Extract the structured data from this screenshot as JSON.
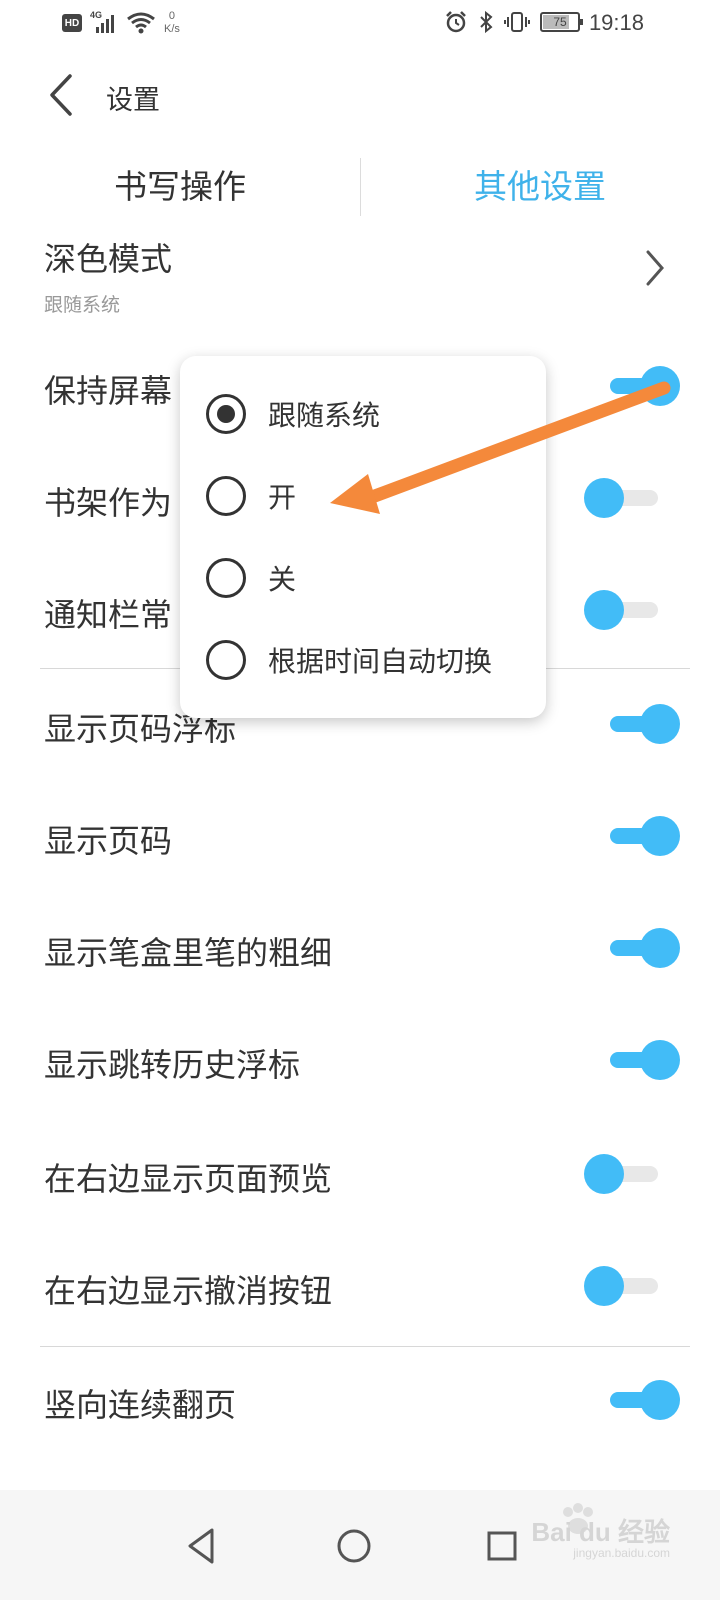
{
  "status_bar": {
    "hd": "HD",
    "network": "4G",
    "speed_value": "0",
    "speed_unit": "K/s",
    "battery": "75",
    "time": "19:18"
  },
  "header": {
    "title": "设置"
  },
  "tabs": [
    {
      "label": "书写操作",
      "active": false
    },
    {
      "label": "其他设置",
      "active": true
    }
  ],
  "dark_mode": {
    "label": "深色模式",
    "value": "跟随系统"
  },
  "settings": [
    {
      "label": "保持屏幕",
      "enabled": true
    },
    {
      "label": "书架作为",
      "enabled": false
    },
    {
      "label": "通知栏常",
      "enabled": false
    },
    {
      "label": "显示页码浮标",
      "enabled": true
    },
    {
      "label": "显示页码",
      "enabled": true
    },
    {
      "label": "显示笔盒里笔的粗细",
      "enabled": true
    },
    {
      "label": "显示跳转历史浮标",
      "enabled": true
    },
    {
      "label": "在右边显示页面预览",
      "enabled": false
    },
    {
      "label": "在右边显示撤消按钮",
      "enabled": false
    },
    {
      "label": "竖向连续翻页",
      "enabled": true
    }
  ],
  "popup": {
    "options": [
      {
        "label": "跟随系统",
        "selected": true
      },
      {
        "label": "开",
        "selected": false
      },
      {
        "label": "关",
        "selected": false
      },
      {
        "label": "根据时间自动切换",
        "selected": false
      }
    ]
  },
  "watermark": {
    "brand": "Bai du 经验",
    "site": "jingyan.baidu.com"
  },
  "colors": {
    "accent": "#42bcf7",
    "tab_active": "#3fb2ea",
    "annotation_arrow": "#f4893b"
  },
  "icons": {
    "back": "chevron-left-icon",
    "row_arrow": "chevron-right-icon",
    "nav_back": "triangle-back-icon",
    "nav_home": "circle-home-icon",
    "nav_recent": "square-recent-icon"
  }
}
